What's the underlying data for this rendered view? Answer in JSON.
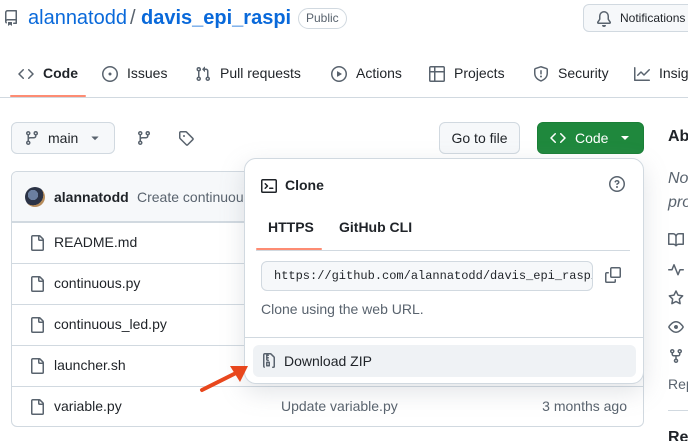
{
  "header": {
    "owner": "alannatodd",
    "separator": "/",
    "repo": "davis_epi_raspi",
    "visibility": "Public",
    "notifications_label": "Notifications"
  },
  "tabs": [
    {
      "label": "Code",
      "icon": "code-icon",
      "active": true
    },
    {
      "label": "Issues",
      "icon": "issue-icon"
    },
    {
      "label": "Pull requests",
      "icon": "pull-request-icon"
    },
    {
      "label": "Actions",
      "icon": "play-icon"
    },
    {
      "label": "Projects",
      "icon": "table-icon"
    },
    {
      "label": "Security",
      "icon": "shield-icon"
    },
    {
      "label": "Insig",
      "icon": "graph-icon"
    }
  ],
  "toolbar": {
    "branch": "main",
    "goto_file": "Go to file",
    "code_button": "Code"
  },
  "commit": {
    "author": "alannatodd",
    "message": "Create continuous"
  },
  "files": [
    {
      "name": "README.md",
      "message": "",
      "time": ""
    },
    {
      "name": "continuous.py",
      "message": "",
      "time": ""
    },
    {
      "name": "continuous_led.py",
      "message": "",
      "time": ""
    },
    {
      "name": "launcher.sh",
      "message": "",
      "time": ""
    },
    {
      "name": "variable.py",
      "message": "Update variable.py",
      "time": "3 months ago"
    }
  ],
  "about": {
    "title": "Ab",
    "desc_line1": "No",
    "desc_line2": "pro",
    "rep": "Rep",
    "next_heading": "Re"
  },
  "clone_popover": {
    "title": "Clone",
    "tabs": [
      "HTTPS",
      "GitHub CLI"
    ],
    "active_tab": "HTTPS",
    "url": "https://github.com/alannatodd/davis_epi_raspi.git",
    "hint": "Clone using the web URL.",
    "download_label": "Download ZIP"
  },
  "colors": {
    "link": "#0969da",
    "code_button": "#1f883d",
    "tab_underline": "#fd8c73",
    "annotation_arrow": "#e8471d"
  }
}
